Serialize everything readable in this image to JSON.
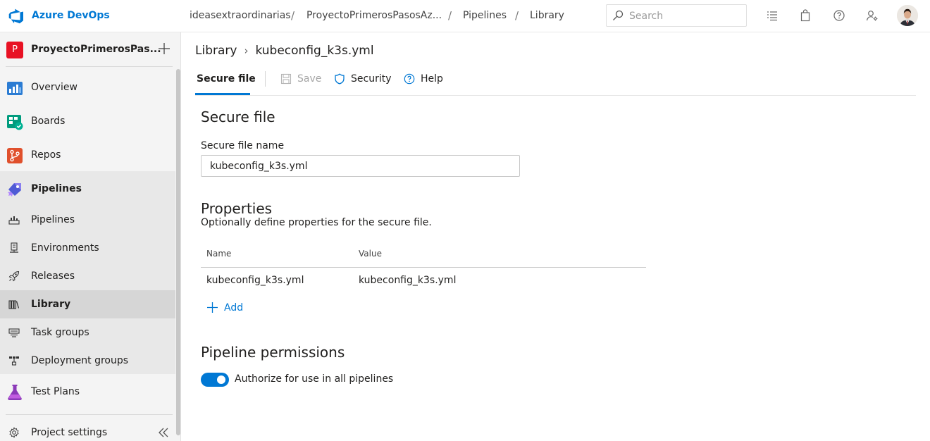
{
  "topbar": {
    "brand": "Azure DevOps",
    "breadcrumb": [
      "ideasextraordinarias",
      "ProyectoPrimerosPasosAz...",
      "Pipelines",
      "Library"
    ],
    "search_placeholder": "Search"
  },
  "sidebar": {
    "project_initial": "P",
    "project_name": "ProyectoPrimerosPas...",
    "items": [
      {
        "label": "Overview"
      },
      {
        "label": "Boards"
      },
      {
        "label": "Repos"
      },
      {
        "label": "Pipelines"
      },
      {
        "label": "Pipelines"
      },
      {
        "label": "Environments"
      },
      {
        "label": "Releases"
      },
      {
        "label": "Library"
      },
      {
        "label": "Task groups"
      },
      {
        "label": "Deployment groups"
      },
      {
        "label": "Test Plans"
      }
    ],
    "settings_label": "Project settings"
  },
  "main": {
    "crumb_root": "Library",
    "crumb_current": "kubeconfig_k3s.yml",
    "tab_label": "Secure file",
    "cmd_save": "Save",
    "cmd_security": "Security",
    "cmd_help": "Help",
    "section_title": "Secure file",
    "name_label": "Secure file name",
    "name_value": "kubeconfig_k3s.yml",
    "properties_title": "Properties",
    "properties_desc": "Optionally define properties for the secure file.",
    "columns": [
      "Name",
      "Value"
    ],
    "rows": [
      {
        "name": "kubeconfig_k3s.yml",
        "value": "kubeconfig_k3s.yml"
      }
    ],
    "add_label": "Add",
    "permissions_title": "Pipeline permissions",
    "authorize_label": "Authorize for use in all pipelines",
    "authorize_on": true
  },
  "colors": {
    "accent": "#0078d4",
    "project_badge": "#e81123"
  }
}
